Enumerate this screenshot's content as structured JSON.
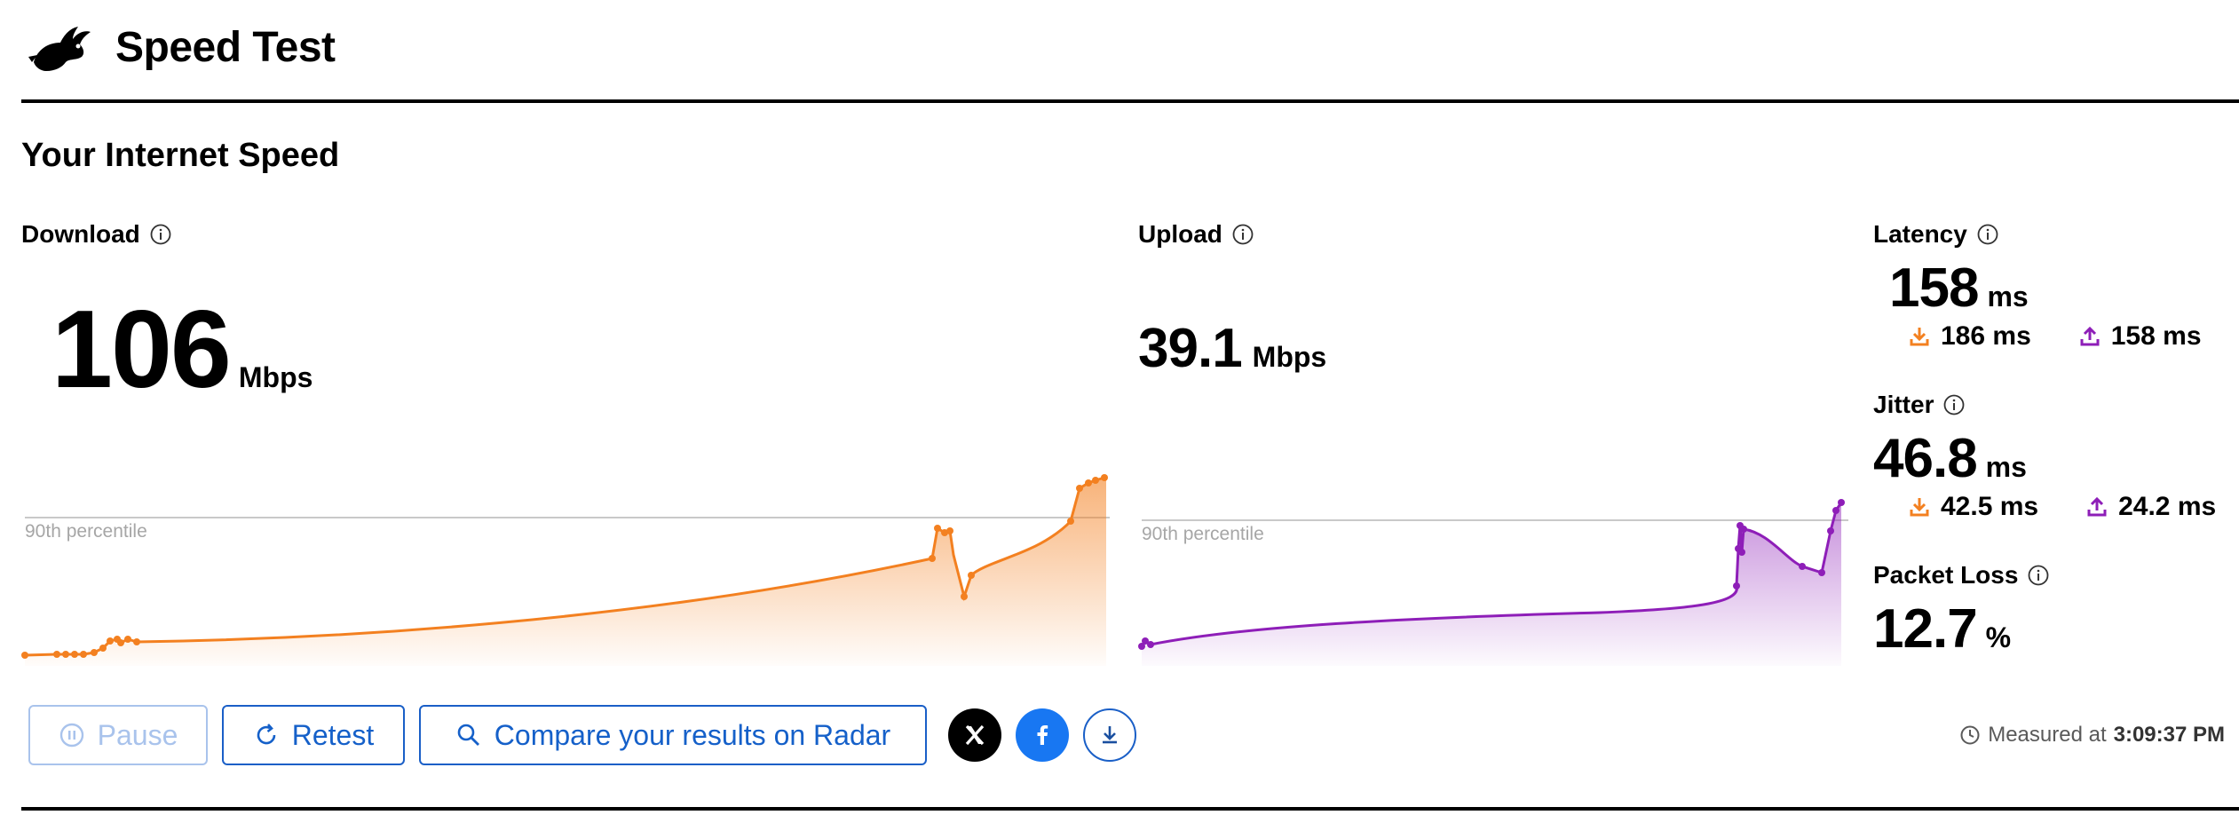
{
  "header": {
    "title": "Speed Test",
    "logo_icon": "rabbit-icon"
  },
  "section_title": "Your Internet Speed",
  "download": {
    "label": "Download",
    "value": "106",
    "unit": "Mbps",
    "percentile_label": "90th percentile",
    "color": "#f38020"
  },
  "upload": {
    "label": "Upload",
    "value": "39.1",
    "unit": "Mbps",
    "percentile_label": "90th percentile",
    "color": "#8e1eb8"
  },
  "latency": {
    "label": "Latency",
    "value": "158",
    "unit": "ms",
    "down_value": "186 ms",
    "up_value": "158 ms"
  },
  "jitter": {
    "label": "Jitter",
    "value": "46.8",
    "unit": "ms",
    "down_value": "42.5 ms",
    "up_value": "24.2 ms"
  },
  "packet_loss": {
    "label": "Packet Loss",
    "value": "12.7",
    "unit": "%"
  },
  "actions": {
    "pause_label": "Pause",
    "retest_label": "Retest",
    "compare_label": "Compare your results on Radar",
    "share_x_icon": "x-logo-icon",
    "share_facebook_icon": "facebook-icon",
    "download_icon": "download-icon"
  },
  "measured": {
    "prefix": "Measured at",
    "time": "3:09:37 PM"
  },
  "colors": {
    "accent_blue": "#1560c9",
    "download": "#f38020",
    "upload": "#8e1eb8"
  }
}
